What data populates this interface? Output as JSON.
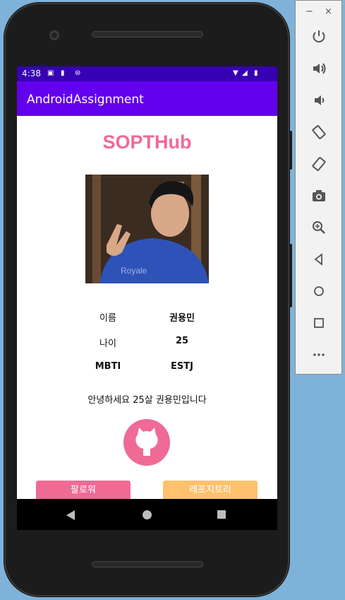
{
  "status_bar": {
    "time": "4:38"
  },
  "app_bar": {
    "title": "AndroidAssignment"
  },
  "logo": "SOPTHub",
  "profile": {
    "name_label": "이름",
    "name_value": "권용민",
    "age_label": "나이",
    "age_value": "25",
    "mbti_label": "MBTI",
    "mbti_value": "ESTJ",
    "intro": "안녕하세요 25살 권용민입니다"
  },
  "buttons": {
    "follower_label": "팔로워",
    "repository_label": "레포지토리"
  },
  "colors": {
    "primary": "#6200ee",
    "primary_dark": "#3700b3",
    "accent_pink": "#ef6a95",
    "accent_yellow": "#ffc16b"
  },
  "emulator_controls": [
    "power-icon",
    "volume-up-icon",
    "volume-down-icon",
    "rotate-left-icon",
    "rotate-right-icon",
    "camera-icon",
    "zoom-icon",
    "back-icon",
    "home-icon",
    "overview-icon",
    "more-icon"
  ]
}
